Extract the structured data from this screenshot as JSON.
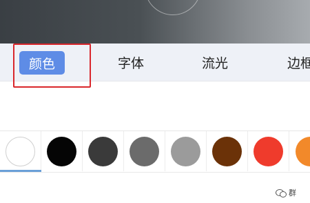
{
  "tabs": [
    {
      "label": "颜色",
      "active": true
    },
    {
      "label": "字体",
      "active": false
    },
    {
      "label": "流光",
      "active": false
    },
    {
      "label": "边框",
      "active": false
    }
  ],
  "colors": {
    "tab_active_bg": "#5e8ce6",
    "tab_bar_bg": "#eef1f7",
    "highlight_border": "#d9262b",
    "selected_indicator": "#6aa0d8"
  },
  "swatches": [
    {
      "name": "white",
      "color": "#ffffff",
      "selected": true
    },
    {
      "name": "black",
      "color": "#050505",
      "selected": false
    },
    {
      "name": "dark-gray",
      "color": "#3a3a3a",
      "selected": false
    },
    {
      "name": "gray",
      "color": "#6b6b6b",
      "selected": false
    },
    {
      "name": "light-gray",
      "color": "#9b9b9b",
      "selected": false
    },
    {
      "name": "brown",
      "color": "#6b3208",
      "selected": false
    },
    {
      "name": "red",
      "color": "#ef3b2c",
      "selected": false
    },
    {
      "name": "orange",
      "color": "#f2892a",
      "selected": false
    }
  ],
  "watermark": {
    "icon": "wechat-icon",
    "text": "群"
  }
}
